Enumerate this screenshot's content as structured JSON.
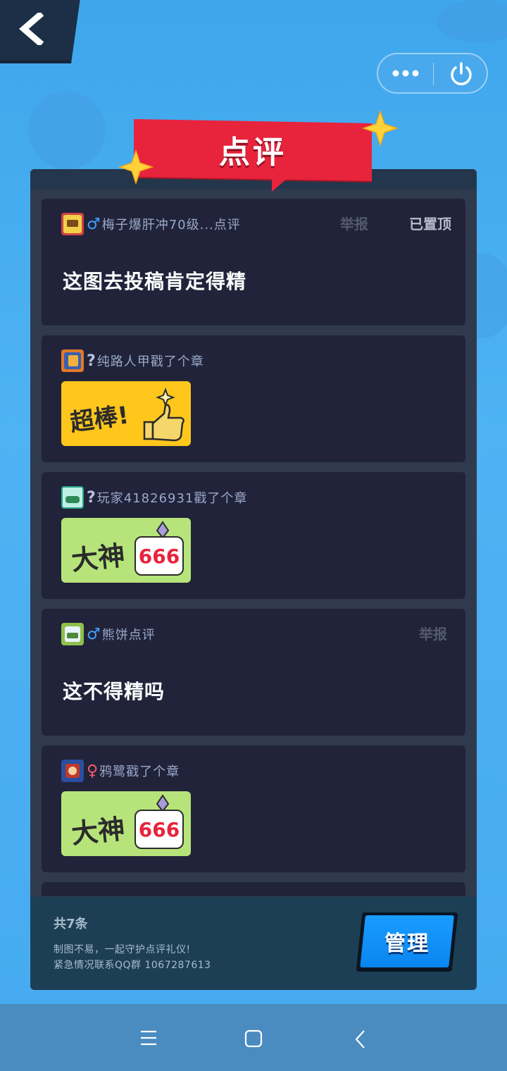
{
  "header": {
    "back_icon": "chevron-left-icon",
    "more_icon": "more-dots-icon",
    "power_icon": "power-icon"
  },
  "panel": {
    "title": "点评"
  },
  "reviews": [
    {
      "user": "梅子爆肝冲70级...点评",
      "gender": "♂",
      "gender_color": "#3fa0ff",
      "report_label": "举报",
      "pinned_label": "已置顶",
      "comment": "这图去投稿肯定得精"
    },
    {
      "user": "纯路人甲戳了个章",
      "gender": "?",
      "gender_color": "#b8c2dc",
      "sticker_text": "超棒!"
    },
    {
      "user": "玩家41826931戳了个章",
      "gender": "?",
      "gender_color": "#b8c2dc",
      "sticker_text_main": "大神",
      "sticker_text_badge": "666"
    },
    {
      "user": "熊饼点评",
      "gender": "♂",
      "gender_color": "#3fa0ff",
      "report_label": "举报",
      "comment": "这不得精吗"
    },
    {
      "user": "鸦鹭戳了个章",
      "gender": "♀",
      "gender_color": "#ff5a6e",
      "sticker_text_main": "大神",
      "sticker_text_badge": "666"
    }
  ],
  "footer": {
    "count": "共7条",
    "note_line1": "制图不易，一起守护点评礼仪!",
    "note_line2": "紧急情况联系QQ群 1067287613",
    "manage_label": "管理"
  },
  "navbar": {
    "menu_icon": "menu-icon",
    "home_icon": "home-square-icon",
    "back_icon": "nav-back-icon"
  }
}
